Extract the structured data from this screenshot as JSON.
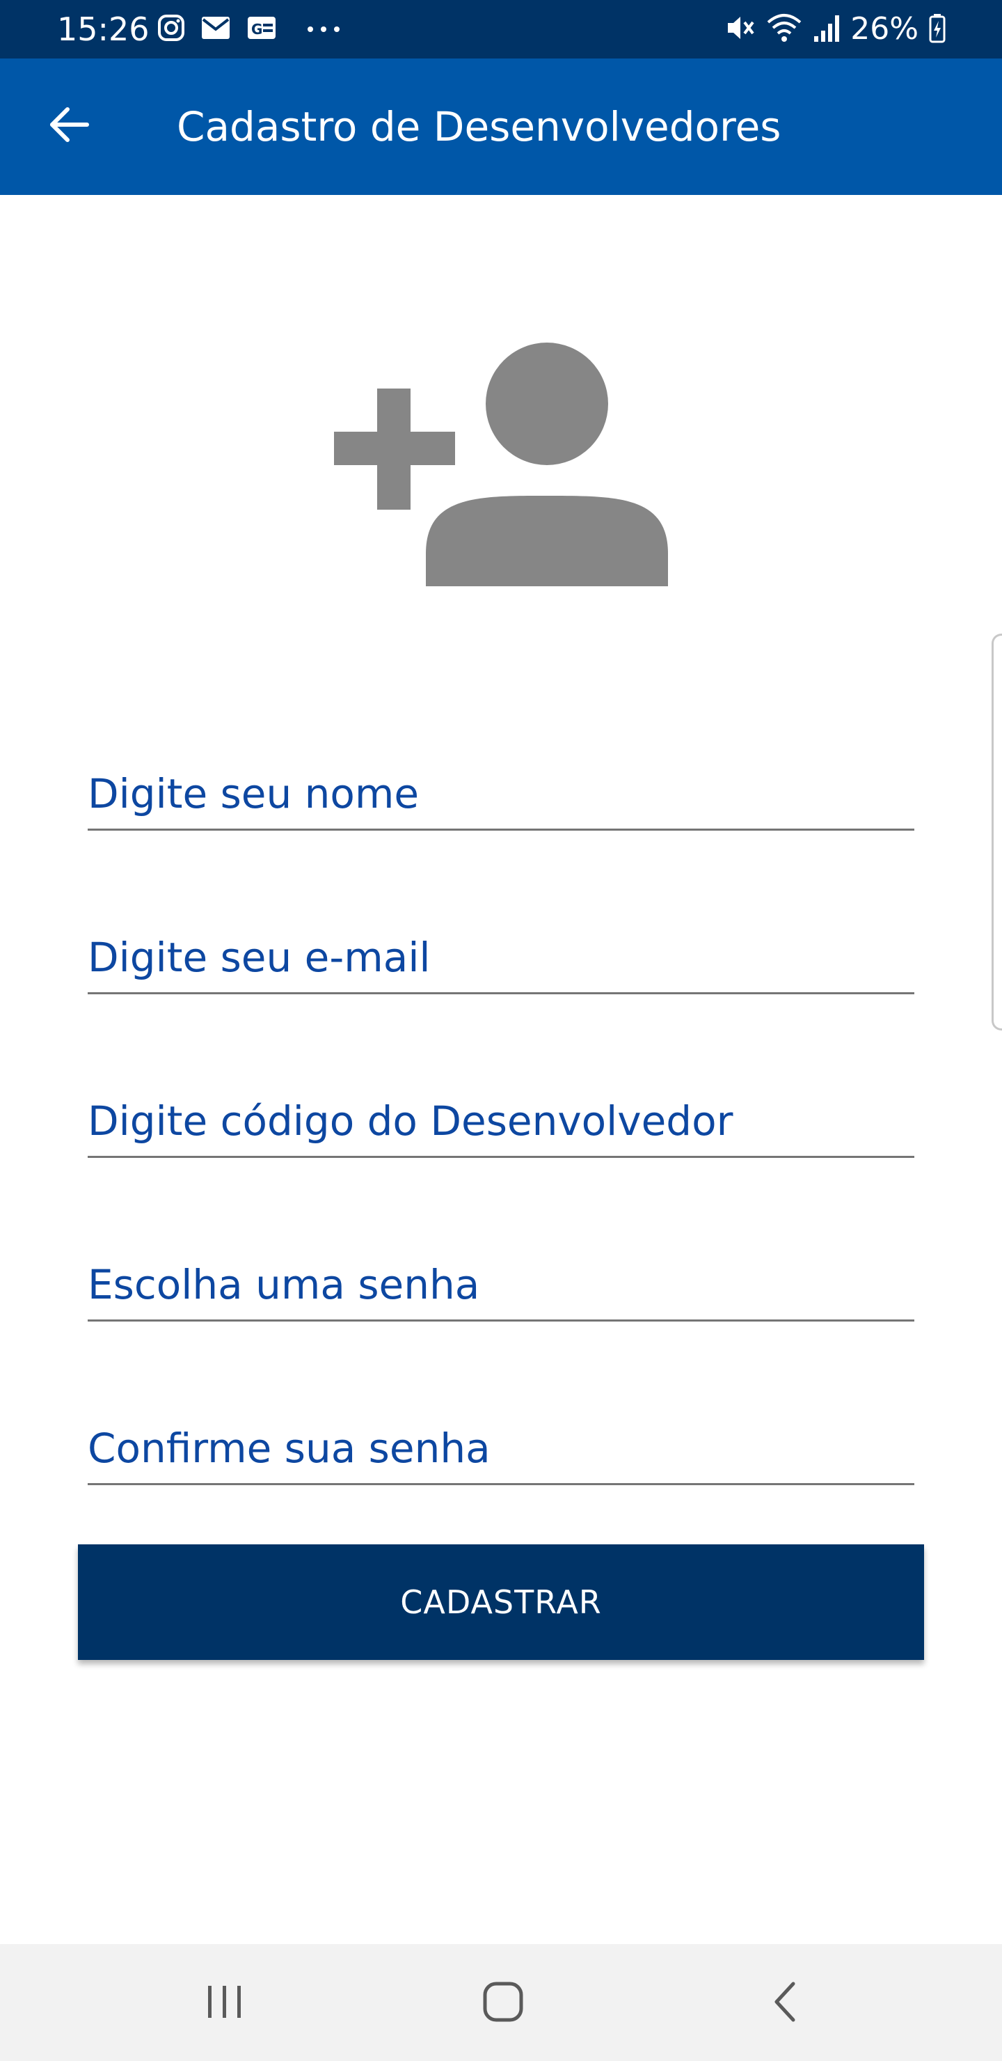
{
  "status_bar": {
    "time": "15:26",
    "battery_percent": "26%",
    "left_icons": [
      "instagram-icon",
      "mail-icon",
      "news-icon",
      "more-dots-icon"
    ],
    "right_icons": [
      "mute-icon",
      "wifi-icon",
      "signal-icon",
      "battery-charging-icon"
    ]
  },
  "app_bar": {
    "title": "Cadastro de Desenvolvedores",
    "back_icon": "arrow-back-icon"
  },
  "form": {
    "header_icon": "add-user-icon",
    "fields": [
      {
        "name": "name",
        "value": "",
        "placeholder": "Digite seu nome"
      },
      {
        "name": "email",
        "value": "",
        "placeholder": "Digite seu e-mail"
      },
      {
        "name": "developer_code",
        "value": "",
        "placeholder": "Digite código do Desenvolvedor"
      },
      {
        "name": "password",
        "value": "",
        "placeholder": "Escolha uma senha"
      },
      {
        "name": "password_confirm",
        "value": "",
        "placeholder": "Confirme sua senha"
      }
    ],
    "submit_label": "CADASTRAR"
  },
  "nav_bar": {
    "buttons": [
      "recents-icon",
      "home-icon",
      "back-icon"
    ]
  },
  "colors": {
    "status_bar": "#003366",
    "app_bar": "#0057a8",
    "text_blue": "#0d47a1",
    "button": "#003366",
    "icon_gray": "#868686",
    "nav_bar": "#f2f2f2"
  }
}
